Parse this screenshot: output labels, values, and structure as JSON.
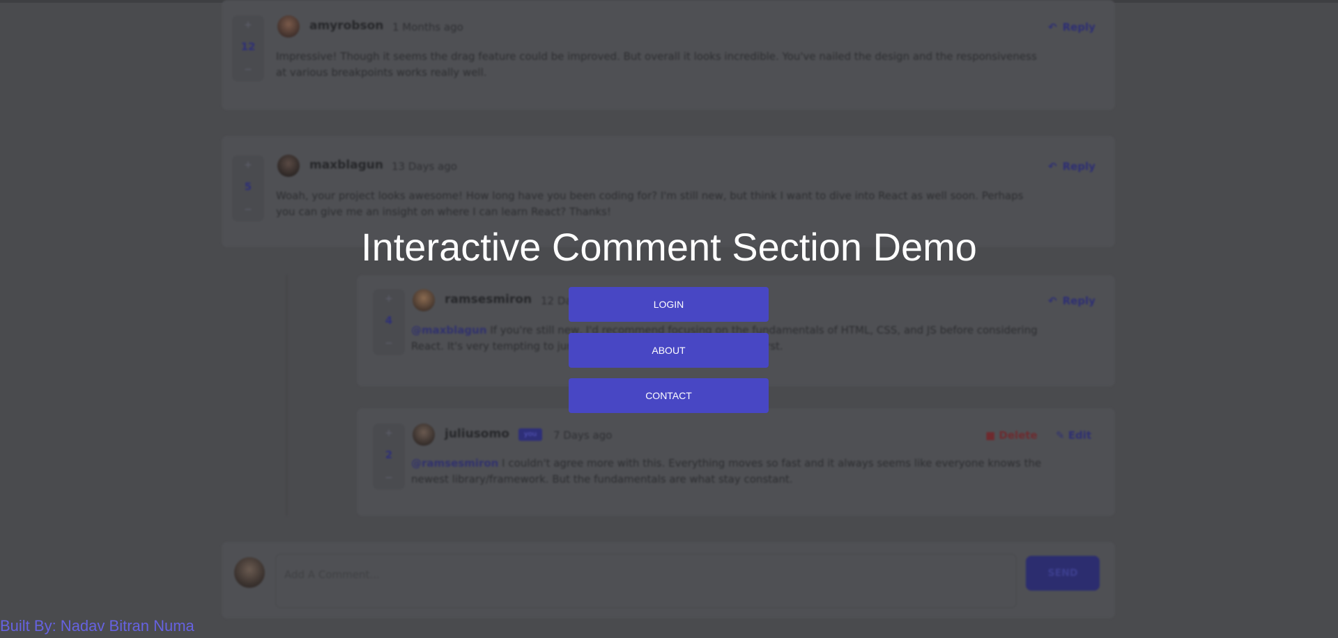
{
  "comments": [
    {
      "user": "amyrobson",
      "time": "1 Months ago",
      "score": "12",
      "reply": "Reply",
      "text": "Impressive! Though it seems the drag feature could be improved. But overall it looks incredible. You've nailed the design and the responsiveness at various breakpoints works really well."
    },
    {
      "user": "maxblagun",
      "time": "13 Days ago",
      "score": "5",
      "reply": "Reply",
      "text": "Woah, your project looks awesome! How long have you been coding for? I'm still new, but think I want to dive into React as well soon. Perhaps you can give me an insight on where I can learn React? Thanks!"
    }
  ],
  "replies": [
    {
      "user": "ramsesmiron",
      "time": "12 Days ago",
      "score": "4",
      "reply": "Reply",
      "mention": "@maxblagun",
      "text": "If you're still new, I'd recommend focusing on the fundamentals of HTML, CSS, and JS before considering React. It's very tempting to jump ahead but lay a solid foundation first."
    },
    {
      "user": "juliusomo",
      "badge": "you",
      "time": "7 Days ago",
      "score": "2",
      "delete": "Delete",
      "edit": "Edit",
      "mention": "@ramsesmiron",
      "text": "I couldn't agree more with this. Everything moves so fast and it always seems like everyone knows the newest library/framework. But the fundamentals are what stay constant."
    }
  ],
  "vote": {
    "plus": "+",
    "minus": "−"
  },
  "add_comment": {
    "placeholder": "Add A Comment...",
    "send_label": "SEND"
  },
  "overlay": {
    "title": "Interactive Comment Section Demo",
    "buttons": [
      "LOGIN",
      "ABOUT",
      "CONTACT"
    ]
  },
  "footer": {
    "text": "Built By: Nadav Bitran Numa"
  },
  "colors": {
    "accent": "#4847c4",
    "footer": "#6662e0",
    "overlay_bg": "#4a4b4e"
  }
}
